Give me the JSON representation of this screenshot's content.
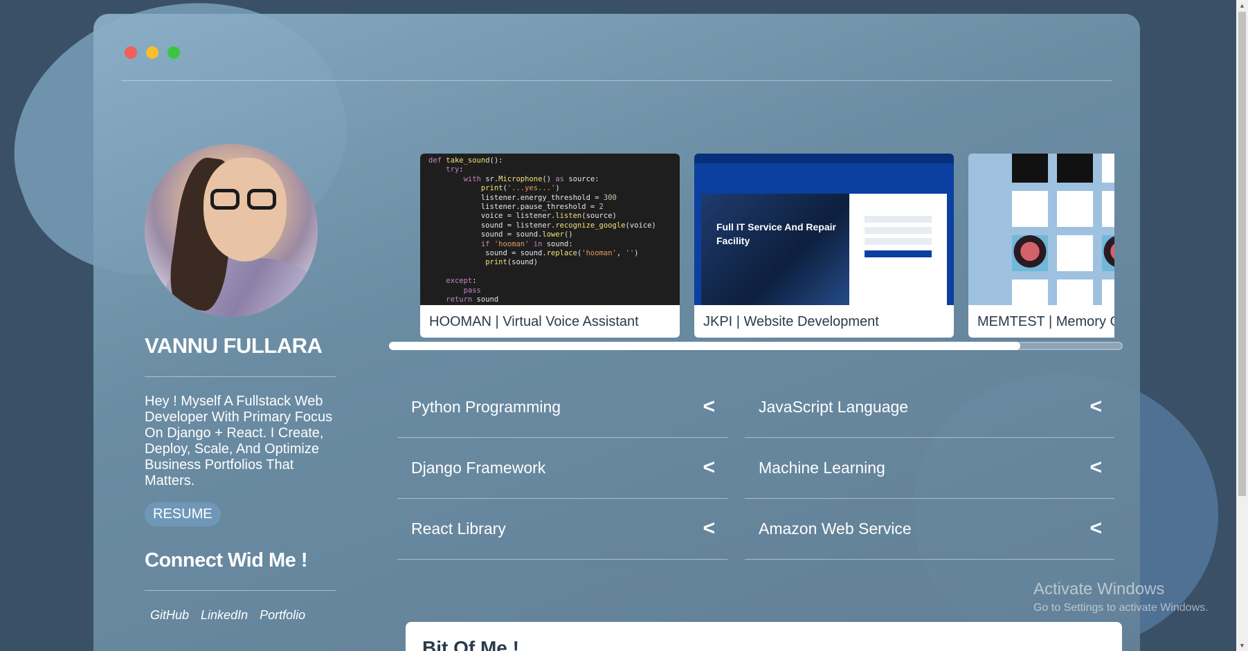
{
  "window": {
    "controls": [
      "close",
      "minimize",
      "maximize"
    ]
  },
  "profile": {
    "name": "VANNU FULLARA",
    "bio": "Hey ! Myself A Fullstack Web Developer With Primary Focus On Django + React. I Create, Deploy, Scale, And Optimize Business Portfolios That Matters.",
    "resume_label": "RESUME",
    "connect_heading": "Connect Wid Me !",
    "links": [
      "GitHub",
      "LinkedIn",
      "Portfolio"
    ]
  },
  "projects": [
    {
      "label": "HOOMAN | Virtual Voice Assistant",
      "thumbnail": "code-screenshot"
    },
    {
      "label": "JKPI | Website Development",
      "thumbnail": "website-screenshot",
      "hero_text": "Full IT Service And Repair Facility"
    },
    {
      "label": "MEMTEST | Memory Game",
      "thumbnail": "memory-game-screenshot"
    }
  ],
  "carousel": {
    "scroll_progress": 0.86
  },
  "skills": [
    {
      "name": "Python Programming",
      "arrow": "<"
    },
    {
      "name": "JavaScript Language",
      "arrow": "<"
    },
    {
      "name": "Django Framework",
      "arrow": "<"
    },
    {
      "name": "Machine Learning",
      "arrow": "<"
    },
    {
      "name": "React Library",
      "arrow": "<"
    },
    {
      "name": "Amazon Web Service",
      "arrow": "<"
    }
  ],
  "about": {
    "heading": "Bit Of Me !"
  },
  "watermark": {
    "line1": "Activate Windows",
    "line2": "Go to Settings to activate Windows."
  },
  "colors": {
    "background": "#3a5066",
    "accent": "#6f98b8",
    "close": "#f25f58",
    "minimize": "#f9bd2e",
    "maximize": "#3bc640"
  }
}
